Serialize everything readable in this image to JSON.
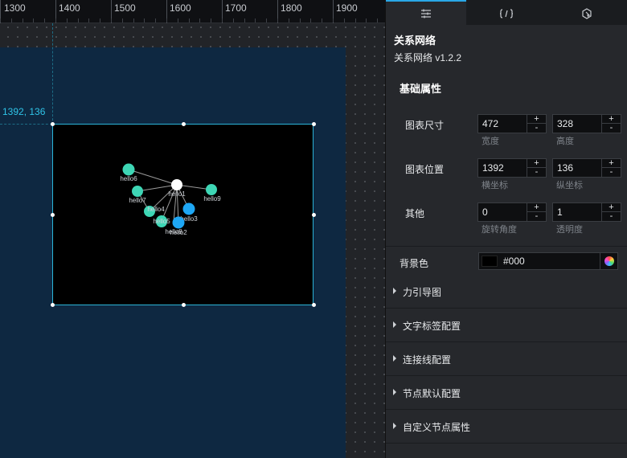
{
  "ruler": {
    "ticks": [
      "1300",
      "1400",
      "1500",
      "1600",
      "1700",
      "1800",
      "1900"
    ]
  },
  "canvas": {
    "coord_label": "1392, 136",
    "graph": {
      "links": [
        [
          "hello1",
          "hello6"
        ],
        [
          "hello1",
          "hello7"
        ],
        [
          "hello1",
          "hello9"
        ],
        [
          "hello1",
          "hello4"
        ],
        [
          "hello1",
          "hello3"
        ],
        [
          "hello1",
          "hello5"
        ],
        [
          "hello1",
          "hello8"
        ],
        [
          "hello1",
          "hello2"
        ],
        [
          "hello7",
          "hello4"
        ]
      ],
      "nodes": [
        {
          "name": "hello1",
          "color": "#ffffff"
        },
        {
          "name": "hello6",
          "color": "#3ed6b5"
        },
        {
          "name": "hello7",
          "color": "#3ed6b5"
        },
        {
          "name": "hello9",
          "color": "#3ed6b5"
        },
        {
          "name": "hello4",
          "color": "#3ed6b5"
        },
        {
          "name": "hello3",
          "color": "#1ea7f5"
        },
        {
          "name": "hello5",
          "color": "#3ed6b5"
        },
        {
          "name": "hello8",
          "color": "#3ed6b5"
        },
        {
          "name": "hello2",
          "color": "#1ea7f5"
        }
      ],
      "link_color": "#9a9a9a"
    }
  },
  "panel": {
    "tabs": [
      {
        "icon": "sliders-icon",
        "active": true
      },
      {
        "icon": "code-braces-icon",
        "active": false
      },
      {
        "icon": "settings-cursor-icon",
        "active": false
      }
    ],
    "component_title": "关系网络",
    "component_version": "关系网络 v1.2.2",
    "basic_section": "基础属性",
    "size": {
      "label": "图表尺寸",
      "width": "472",
      "height": "328",
      "width_label": "宽度",
      "height_label": "高度"
    },
    "position": {
      "label": "图表位置",
      "x": "1392",
      "y": "136",
      "x_label": "横坐标",
      "y_label": "纵坐标"
    },
    "other": {
      "label": "其他",
      "rotation": "0",
      "opacity": "1",
      "rotation_label": "旋转角度",
      "opacity_label": "透明度"
    },
    "stepper": {
      "plus": "+",
      "minus": "-"
    },
    "background": {
      "label": "背景色",
      "value": "#000",
      "swatch_color": "#000000"
    },
    "sections": [
      "力引导图",
      "文字标签配置",
      "连接线配置",
      "节点默认配置",
      "自定义节点属性"
    ]
  }
}
